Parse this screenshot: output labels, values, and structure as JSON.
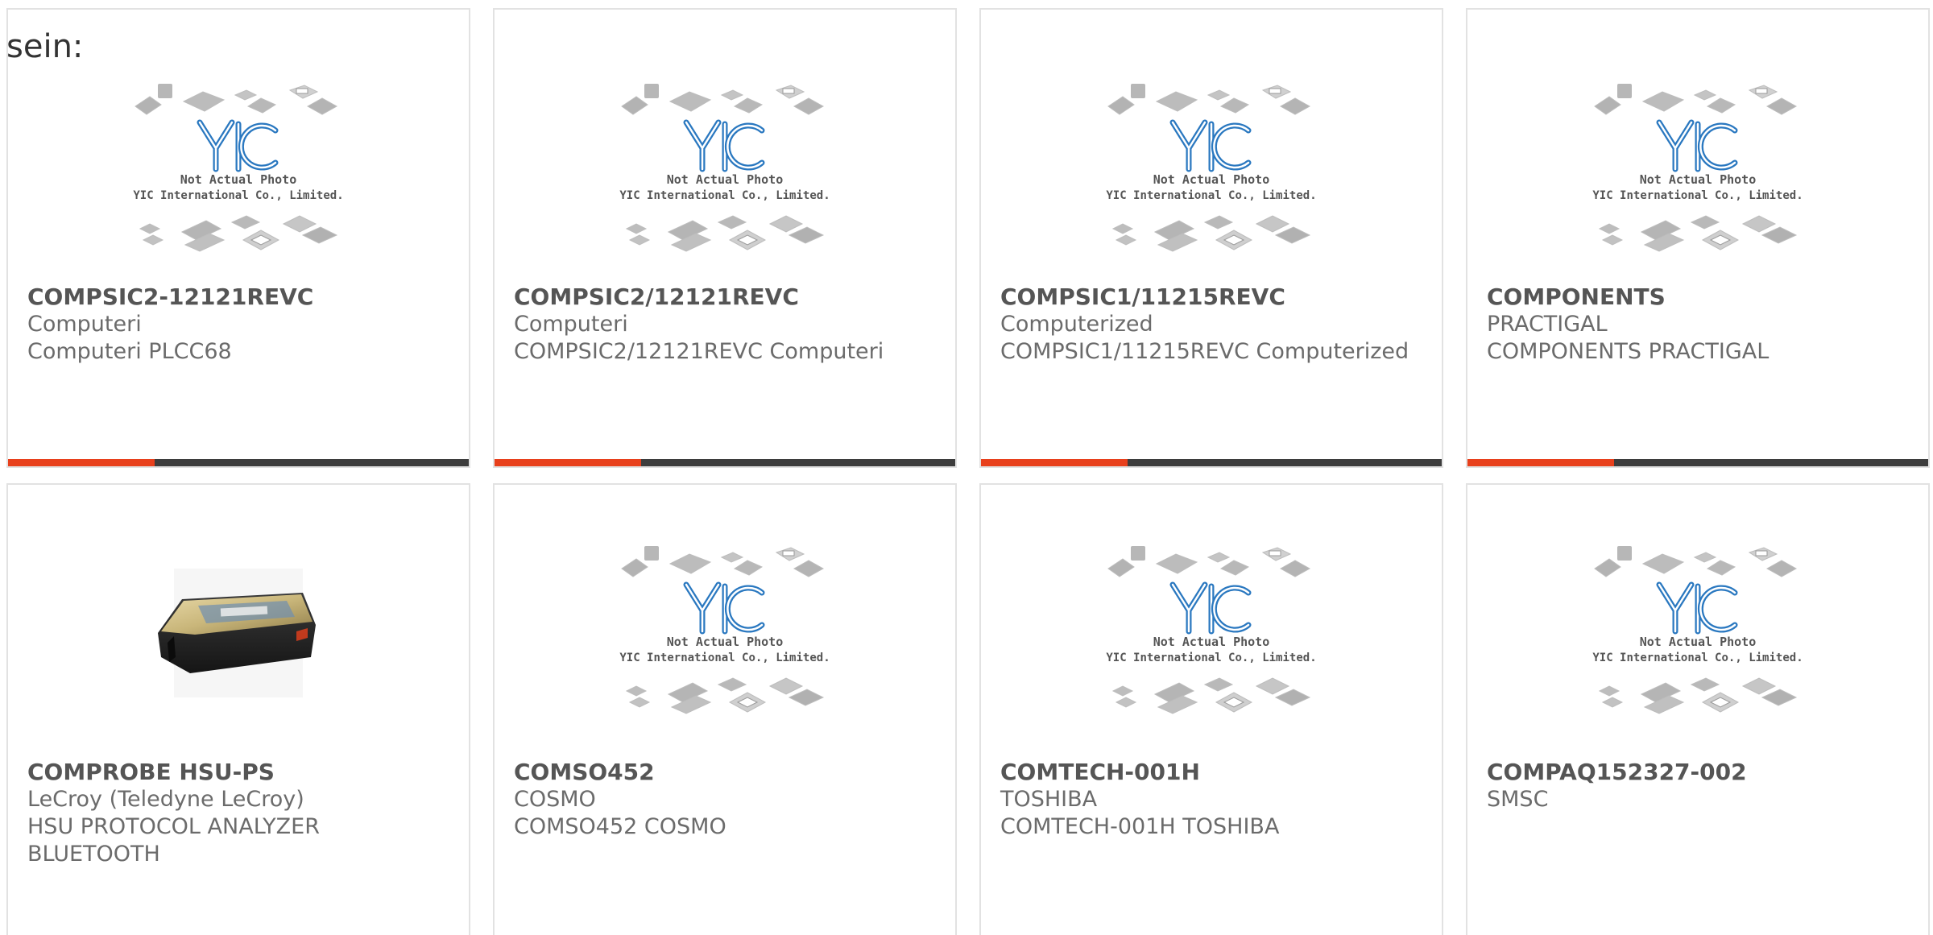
{
  "lead_text": "sein:",
  "colors": {
    "accent": "#e8401c",
    "bar_dark": "#3d3d3d",
    "logo_blue": "#2a78c0"
  },
  "placeholder": {
    "line1": "Not Actual Photo",
    "line2": "YIC International Co., Limited.",
    "logo": "YIC"
  },
  "products": [
    {
      "part_no": "COMPSIC2-12121REVC",
      "brand": "Computeri",
      "desc": "Computeri PLCC68",
      "image": "placeholder-yic"
    },
    {
      "part_no": "COMPSIC2/12121REVC",
      "brand": "Computeri",
      "desc": "COMPSIC2/12121REVC Computeri",
      "image": "placeholder-yic"
    },
    {
      "part_no": "COMPSIC1/11215REVC",
      "brand": "Computerized",
      "desc": "COMPSIC1/11215REVC Computerized",
      "image": "placeholder-yic"
    },
    {
      "part_no": "COMPONENTS",
      "brand": "PRACTIGAL",
      "desc": "COMPONENTS PRACTIGAL",
      "image": "placeholder-yic"
    },
    {
      "part_no": "COMPROBE HSU-PS",
      "brand": "LeCroy (Teledyne LeCroy)",
      "desc": "HSU PROTOCOL ANALYZER BLUETOOTH",
      "image": "device-photo"
    },
    {
      "part_no": "COMSO452",
      "brand": "COSMO",
      "desc": "COMSO452 COSMO",
      "image": "placeholder-yic"
    },
    {
      "part_no": "COMTECH-001H",
      "brand": "TOSHIBA",
      "desc": "COMTECH-001H TOSHIBA",
      "image": "placeholder-yic"
    },
    {
      "part_no": "COMPAQ152327-002",
      "brand": "SMSC",
      "desc": "",
      "image": "placeholder-yic"
    }
  ]
}
